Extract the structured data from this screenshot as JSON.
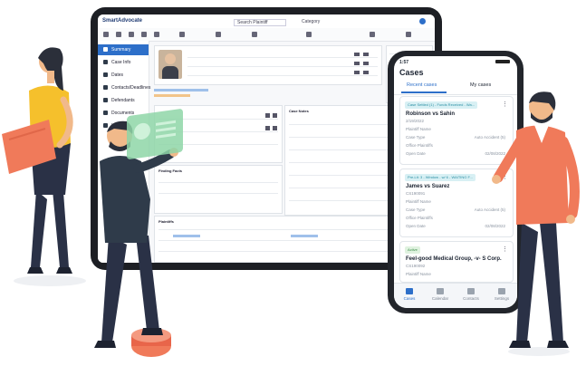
{
  "colors": {
    "accent": "#2d6fc9",
    "skin": "#f1b98a",
    "shirt_yellow": "#f5c02c",
    "shirt_coral": "#f07a5a",
    "holo_green": "#8fd6a8",
    "pants_navy": "#2a3146"
  },
  "tablet": {
    "app_name": "SmartAdvocate",
    "topbar": {
      "search_placeholder": "Search Plaintiff",
      "category_label": "Category"
    },
    "sidebar": [
      {
        "label": "Summary",
        "icon": "home-icon",
        "active": true
      },
      {
        "label": "Case Info",
        "icon": "briefcase-icon"
      },
      {
        "label": "Dates",
        "icon": "calendar-icon"
      },
      {
        "label": "Contacts/Deadlines",
        "icon": "contacts-icon"
      },
      {
        "label": "Defendants",
        "icon": "gavel-icon"
      },
      {
        "label": "Documents",
        "icon": "doc-icon"
      },
      {
        "label": "Liability",
        "icon": "scale-icon"
      }
    ],
    "sections": {
      "case_notes": "Case Notes",
      "finding_facts": "Finding Facts",
      "plaintiffs": "Plaintiffs"
    }
  },
  "phone": {
    "time": "1:57",
    "title": "Cases",
    "tabs": [
      {
        "label": "Recent cases",
        "active": true
      },
      {
        "label": "My cases",
        "active": false
      }
    ],
    "cases": [
      {
        "status": "Case Settled (1) - Funds Received - Wa...",
        "status_bg": "#d8f0f4",
        "status_fg": "#2a8fa4",
        "title": "Robinson vs Sahin",
        "number": "2/19/2022",
        "fields": [
          {
            "label": "Plaintiff Name",
            "value": ""
          },
          {
            "label": "Case Type",
            "value": "Auto Accident (5)"
          },
          {
            "label": "Office Plaintiffs",
            "value": ""
          },
          {
            "label": "Open Date",
            "value": "02/08/2022"
          }
        ]
      },
      {
        "status": "Pre-Lit: 3 - Window - w/ 6 - WAITING F...",
        "status_bg": "#d8f0f4",
        "status_fg": "#2a8fa4",
        "title": "James vs Suarez",
        "number": "CS190091",
        "fields": [
          {
            "label": "Plaintiff Name",
            "value": ""
          },
          {
            "label": "Case Type",
            "value": "Auto Accident (5)"
          },
          {
            "label": "Office Plaintiffs",
            "value": ""
          },
          {
            "label": "Open Date",
            "value": "02/08/2022"
          }
        ]
      },
      {
        "status": "Active",
        "status_bg": "#dff2df",
        "status_fg": "#3e8e4b",
        "title": "Feel-good Medical Group, -v- S Corp.",
        "number": "CS190092",
        "fields": [
          {
            "label": "Plaintiff Name",
            "value": ""
          }
        ]
      }
    ],
    "nav": [
      {
        "label": "Cases",
        "active": true
      },
      {
        "label": "Calendar",
        "active": false
      },
      {
        "label": "Contacts",
        "active": false
      },
      {
        "label": "Settings",
        "active": false
      }
    ]
  }
}
